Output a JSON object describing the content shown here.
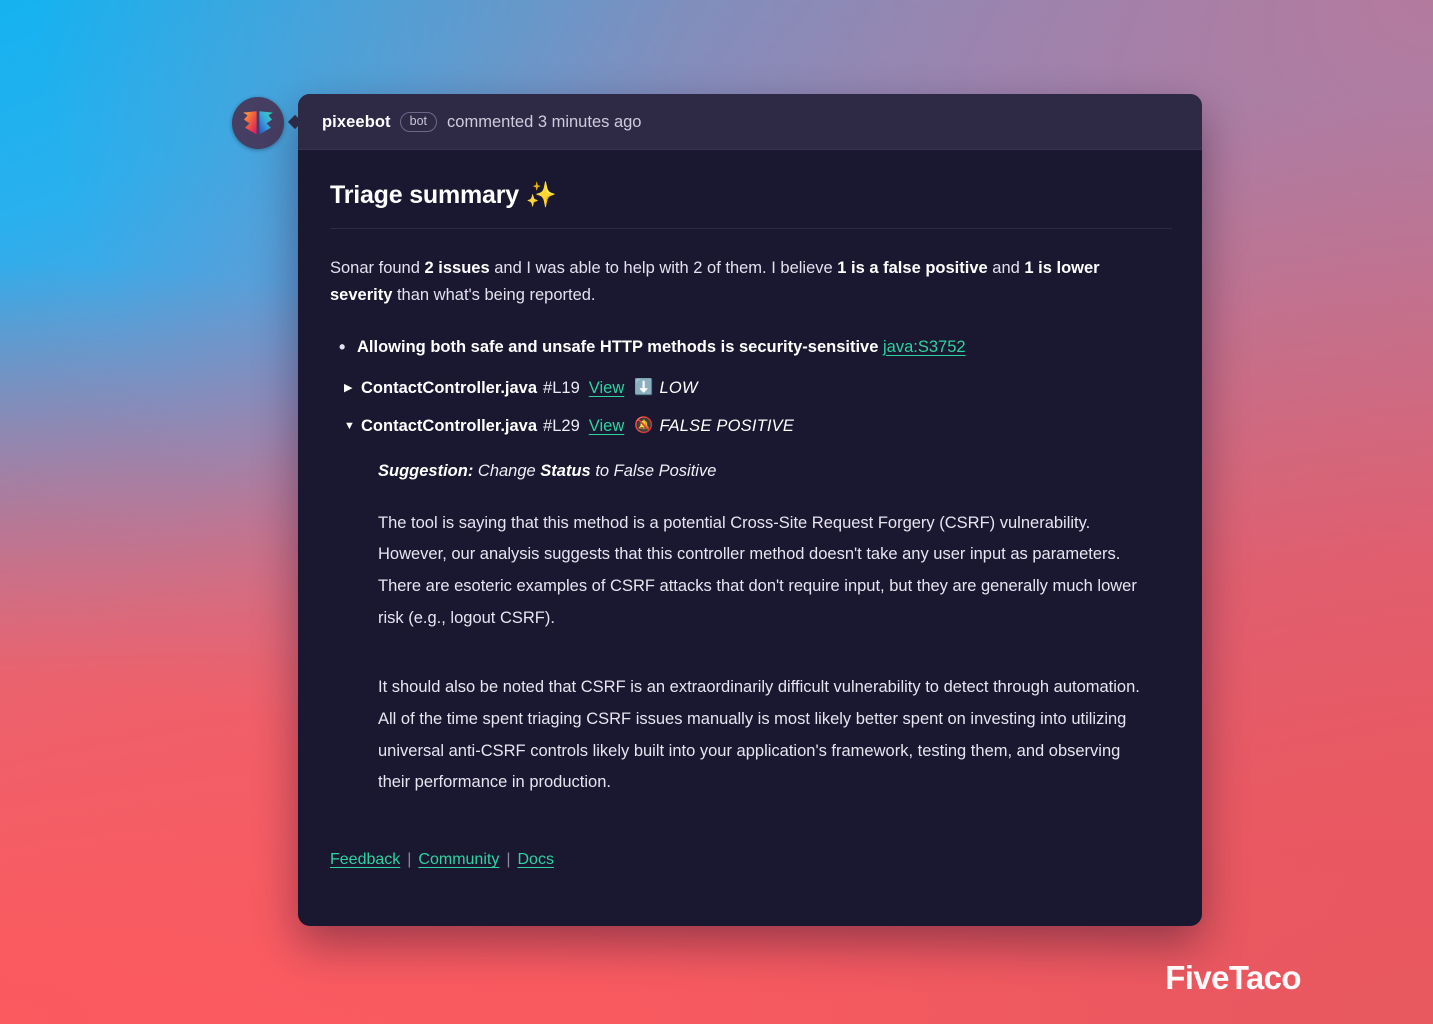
{
  "header": {
    "author": "pixeebot",
    "bot_badge": "bot",
    "commented": "commented 3 minutes ago",
    "avatar_icon": "butterfly-logo-icon"
  },
  "title": "Triage summary ✨",
  "summary": {
    "part1": "Sonar found ",
    "bold1": "2 issues",
    "part2": " and I was able to help with 2 of them. I believe ",
    "bold2": "1 is a false positive",
    "part3": " and ",
    "bold3": "1 is lower severity",
    "part4": " than what's being reported."
  },
  "issues": [
    {
      "rule_title": "Allowing both safe and unsafe HTTP methods is security-sensitive",
      "rule_link": "java:S3752"
    }
  ],
  "findings": [
    {
      "toggle": "▶",
      "expanded": false,
      "file": "ContactController.java",
      "line": "#L19",
      "view_label": "View",
      "severity_icon": "⬇️",
      "severity_icon_name": "down-arrow-icon",
      "severity_label": "LOW"
    },
    {
      "toggle": "▼",
      "expanded": true,
      "file": "ContactController.java",
      "line": "#L29",
      "view_label": "View",
      "severity_icon": "🔕",
      "severity_icon_name": "bell-muted-icon",
      "severity_label": "FALSE POSITIVE"
    }
  ],
  "detail": {
    "suggestion_label": "Suggestion:",
    "suggestion_pre": " Change ",
    "suggestion_bold": "Status",
    "suggestion_post": " to False Positive",
    "paragraph1": "The tool is saying that this method is a potential Cross-Site Request Forgery (CSRF) vulnerability. However, our analysis suggests that this controller method doesn't take any user input as parameters. There are esoteric examples of CSRF attacks that don't require input, but they are generally much lower risk (e.g., logout CSRF).",
    "paragraph2": "It should also be noted that CSRF is an extraordinarily difficult vulnerability to detect through automation. All of the time spent triaging CSRF issues manually is most likely better spent on investing into utilizing universal anti-CSRF controls likely built into your application's framework, testing them, and observing their performance in production."
  },
  "footer": {
    "feedback": "Feedback",
    "community": "Community",
    "docs": "Docs",
    "separator": "|"
  },
  "watermark": "FiveTaco",
  "colors": {
    "link": "#2ed3a0",
    "card_body": "#1a1730",
    "card_header": "#2e2a46",
    "bg_top_left": "#15b2f0",
    "bg_bottom_left": "#fb5a5e"
  }
}
